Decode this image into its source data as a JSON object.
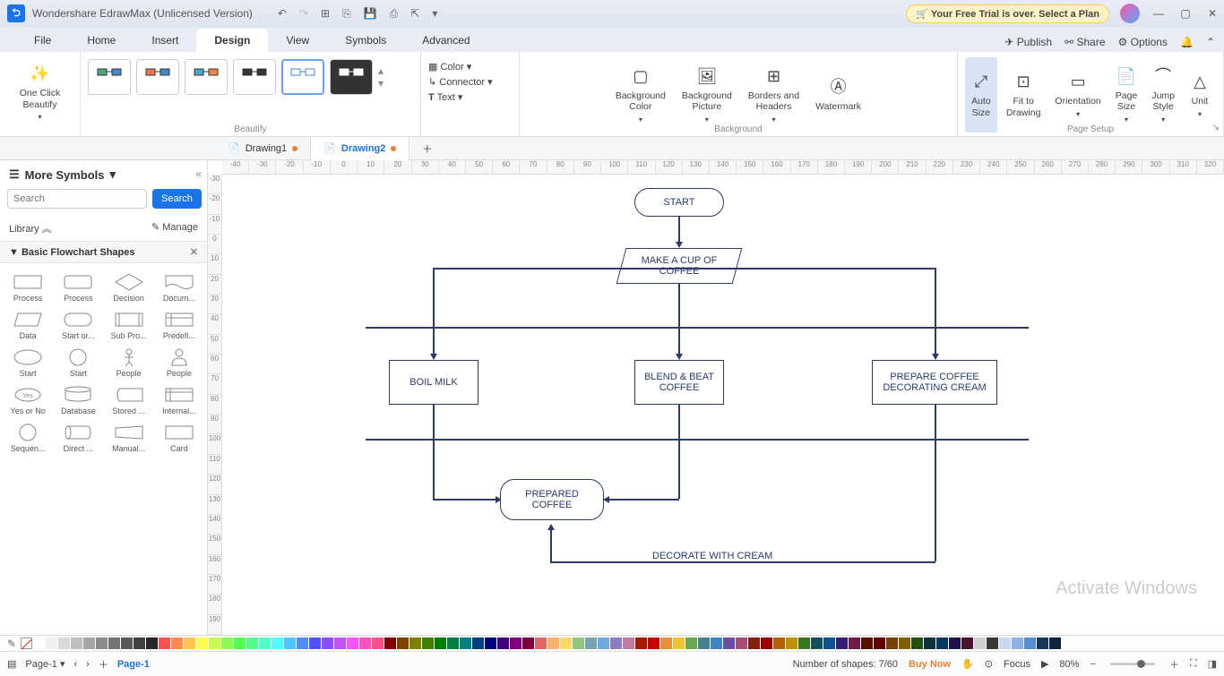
{
  "title": "Wondershare EdrawMax (Unlicensed Version)",
  "trial": "Your Free Trial is over. Select a Plan",
  "menus": [
    "File",
    "Home",
    "Insert",
    "Design",
    "View",
    "Symbols",
    "Advanced"
  ],
  "menu_active": 3,
  "menu_right": {
    "publish": "Publish",
    "share": "Share",
    "options": "Options"
  },
  "ribbon": {
    "oneclick": "One Click\nBeautify",
    "beautify": "Beautify",
    "color": "Color",
    "connector": "Connector",
    "text": "Text",
    "bgcolor": "Background\nColor",
    "bgpic": "Background\nPicture",
    "borders": "Borders and\nHeaders",
    "watermark": "Watermark",
    "background": "Background",
    "autosize": "Auto\nSize",
    "fit": "Fit to\nDrawing",
    "orient": "Orientation",
    "pagesize": "Page\nSize",
    "jump": "Jump\nStyle",
    "unit": "Unit",
    "pagesetup": "Page Setup"
  },
  "doctabs": [
    {
      "name": "Drawing1",
      "active": false
    },
    {
      "name": "Drawing2",
      "active": true
    }
  ],
  "sidebar": {
    "more": "More Symbols",
    "search_ph": "Search",
    "search_btn": "Search",
    "library": "Library",
    "manage": "Manage",
    "category": "Basic Flowchart Shapes",
    "shapes": [
      "Process",
      "Process",
      "Decision",
      "Docum...",
      "Data",
      "Start or...",
      "Sub Pro...",
      "Predefi...",
      "Start",
      "Start",
      "People",
      "People",
      "Yes or No",
      "Database",
      "Stored ...",
      "Internal...",
      "Sequen...",
      "Direct ...",
      "Manual...",
      "Card"
    ]
  },
  "ruler_h": [
    "-40",
    "-30",
    "-20",
    "-10",
    "0",
    "10",
    "20",
    "30",
    "40",
    "50",
    "60",
    "70",
    "80",
    "90",
    "100",
    "110",
    "120",
    "130",
    "140",
    "150",
    "160",
    "170",
    "180",
    "190",
    "200",
    "210",
    "220",
    "230",
    "240",
    "250",
    "260",
    "270",
    "280",
    "290",
    "300",
    "310",
    "320"
  ],
  "ruler_v": [
    "-30",
    "-20",
    "-10",
    "0",
    "10",
    "20",
    "30",
    "40",
    "50",
    "60",
    "70",
    "80",
    "90",
    "100",
    "110",
    "120",
    "130",
    "140",
    "150",
    "160",
    "170",
    "180",
    "190"
  ],
  "flowchart": {
    "start": "START",
    "makeacup": "MAKE A CUP OF COFFEE",
    "boil": "BOIL MILK",
    "blend": "BLEND & BEAT COFFEE",
    "prepare": "PREPARE COFFEE DECORATING CREAM",
    "prepared": "PREPARED COFFEE",
    "decorate": "DECORATE WITH CREAM"
  },
  "watermark": "Activate Windows",
  "status": {
    "page": "Page-1",
    "page2": "Page-1",
    "shapes": "Number of shapes: 7/60",
    "buy": "Buy Now",
    "focus": "Focus",
    "zoom": "80%"
  },
  "swatches": [
    "#ffffff",
    "#f0f0f0",
    "#d9d9d9",
    "#bfbfbf",
    "#a6a6a6",
    "#8c8c8c",
    "#737373",
    "#595959",
    "#404040",
    "#262626",
    "#ff5050",
    "#ff8a50",
    "#ffc450",
    "#fffd50",
    "#c4ff50",
    "#8aff50",
    "#50ff50",
    "#50ff8a",
    "#50ffc4",
    "#50fffd",
    "#50c4ff",
    "#508aff",
    "#5050ff",
    "#8a50ff",
    "#c450ff",
    "#fd50ff",
    "#ff50c4",
    "#ff508a",
    "#800000",
    "#804000",
    "#808000",
    "#408000",
    "#008000",
    "#008040",
    "#008080",
    "#004080",
    "#000080",
    "#400080",
    "#800080",
    "#800040",
    "#e06666",
    "#f6b26b",
    "#ffd966",
    "#93c47d",
    "#76a5af",
    "#6fa8dc",
    "#8e7cc3",
    "#c27ba0",
    "#a61c00",
    "#cc0000",
    "#e69138",
    "#f1c232",
    "#6aa84f",
    "#45818e",
    "#3d85c6",
    "#674ea7",
    "#a64d79",
    "#85200c",
    "#990000",
    "#b45f06",
    "#bf9000",
    "#38761d",
    "#134f5c",
    "#0b5394",
    "#351c75",
    "#741b47",
    "#5b0f00",
    "#660000",
    "#783f04",
    "#7f6000",
    "#274e13",
    "#0c343d",
    "#073763",
    "#20124d",
    "#4c1130",
    "#d0cece",
    "#3b3838",
    "#c6d9f0",
    "#8db3e2",
    "#548dd4",
    "#17365d",
    "#0f243e"
  ]
}
